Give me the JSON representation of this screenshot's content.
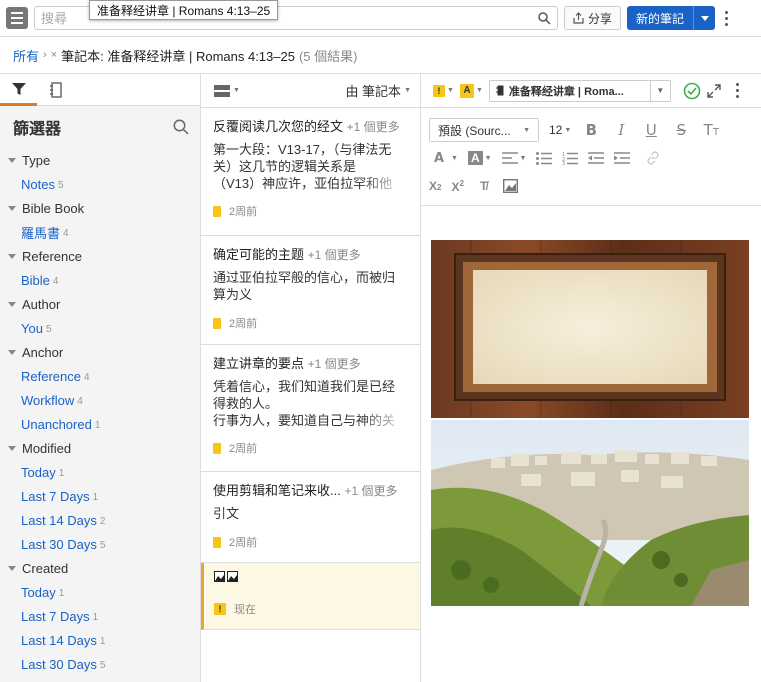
{
  "toolbar": {
    "search_placeholder": "搜尋",
    "tooltip": "准备释经讲章 | Romans 4:13–25",
    "share_label": "分享",
    "new_note_label": "新的筆記"
  },
  "breadcrumb": {
    "root": "所有",
    "current": "筆記本: 准备释经讲章 | Romans 4:13–25",
    "count": "(5 個結果)"
  },
  "filters": {
    "title": "篩選器",
    "groups": [
      {
        "label": "Type",
        "items": [
          {
            "name": "Notes",
            "count": "5"
          }
        ]
      },
      {
        "label": "Bible Book",
        "items": [
          {
            "name": "羅馬書",
            "count": "4"
          }
        ]
      },
      {
        "label": "Reference",
        "items": [
          {
            "name": "Bible",
            "count": "4"
          }
        ]
      },
      {
        "label": "Author",
        "items": [
          {
            "name": "You",
            "count": "5"
          }
        ]
      },
      {
        "label": "Anchor",
        "items": [
          {
            "name": "Reference",
            "count": "4"
          },
          {
            "name": "Workflow",
            "count": "4"
          },
          {
            "name": "Unanchored",
            "count": "1"
          }
        ]
      },
      {
        "label": "Modified",
        "items": [
          {
            "name": "Today",
            "count": "1"
          },
          {
            "name": "Last 7 Days",
            "count": "1"
          },
          {
            "name": "Last 14 Days",
            "count": "2"
          },
          {
            "name": "Last 30 Days",
            "count": "5"
          }
        ]
      },
      {
        "label": "Created",
        "items": [
          {
            "name": "Today",
            "count": "1"
          },
          {
            "name": "Last 7 Days",
            "count": "1"
          },
          {
            "name": "Last 14 Days",
            "count": "1"
          },
          {
            "name": "Last 30 Days",
            "count": "5"
          }
        ]
      }
    ]
  },
  "notes_list": {
    "sort_label": "由 筆記本",
    "notes": [
      {
        "title": "反覆阅读几次您的经文",
        "more": "+1 個更多",
        "body": [
          "第一大段：V13-17，（与律法无",
          "关）这几节的逻辑关系是",
          "（V13）神应许，亚伯拉罕和他"
        ],
        "time": "2周前"
      },
      {
        "title": "确定可能的主题",
        "more": "+1 個更多",
        "body": [
          "通过亚伯拉罕般的信心，而被归",
          "算为义"
        ],
        "time": "2周前"
      },
      {
        "title": "建立讲章的要点",
        "more": "+1 個更多",
        "body": [
          "凭着信心，我们知道我们是已经",
          "得救的人。",
          "行事为人，要知道自己与神的关"
        ],
        "time": "2周前"
      },
      {
        "title": "使用剪辑和笔记来收...",
        "more": "+1 個更多",
        "body": [
          "引文"
        ],
        "time": "2周前"
      },
      {
        "title": "",
        "more": "",
        "body": [],
        "time": "现在"
      }
    ]
  },
  "editor": {
    "notebook_name": "准备释经讲章 | Roma...",
    "font_name": "預設 (Sourc...",
    "font_size": "12"
  },
  "colors": {
    "accent_blue": "#1a62c5",
    "highlight_yellow": "#f5c518",
    "tab_orange": "#e07b24"
  }
}
